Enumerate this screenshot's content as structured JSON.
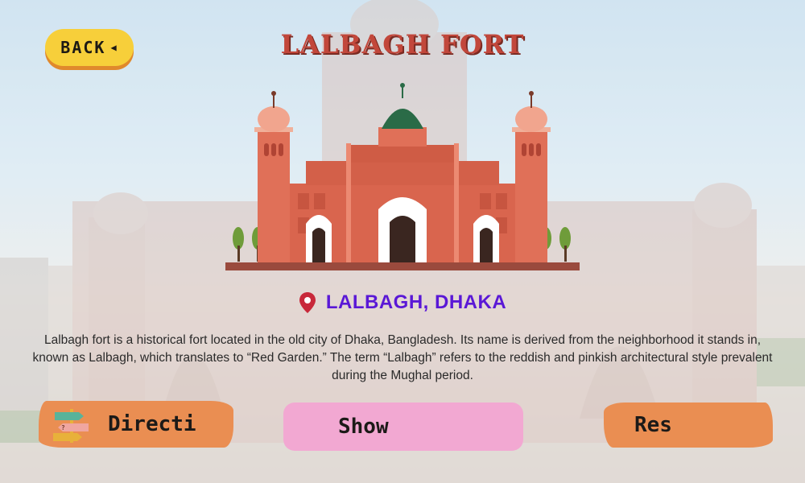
{
  "header": {
    "back_label": "BACK",
    "title": "LALBAGH FORT"
  },
  "location": {
    "icon": "map-pin-icon",
    "text": "LALBAGH, DHAKA"
  },
  "description": "Lalbagh fort is a historical fort located in the old city of Dhaka, Bangladesh. Its name is derived from the neighborhood it stands in, known as Lalbagh, which translates to “Red Garden.” The term “Lalbagh” refers to the reddish and pinkish architectural style prevalent during the Mughal period.",
  "actions": {
    "directions_label": "Directi",
    "show_label": "Show",
    "res_label": "Res"
  },
  "colors": {
    "back_button": "#f7cf3a",
    "title": "#c2473b",
    "location_text": "#5a18d6",
    "pin": "#c8283a",
    "brush_orange": "#ea8e52",
    "brush_pink": "#f2a8d2",
    "fort_body": "#d9654e",
    "fort_dome_green": "#2a6b47"
  }
}
